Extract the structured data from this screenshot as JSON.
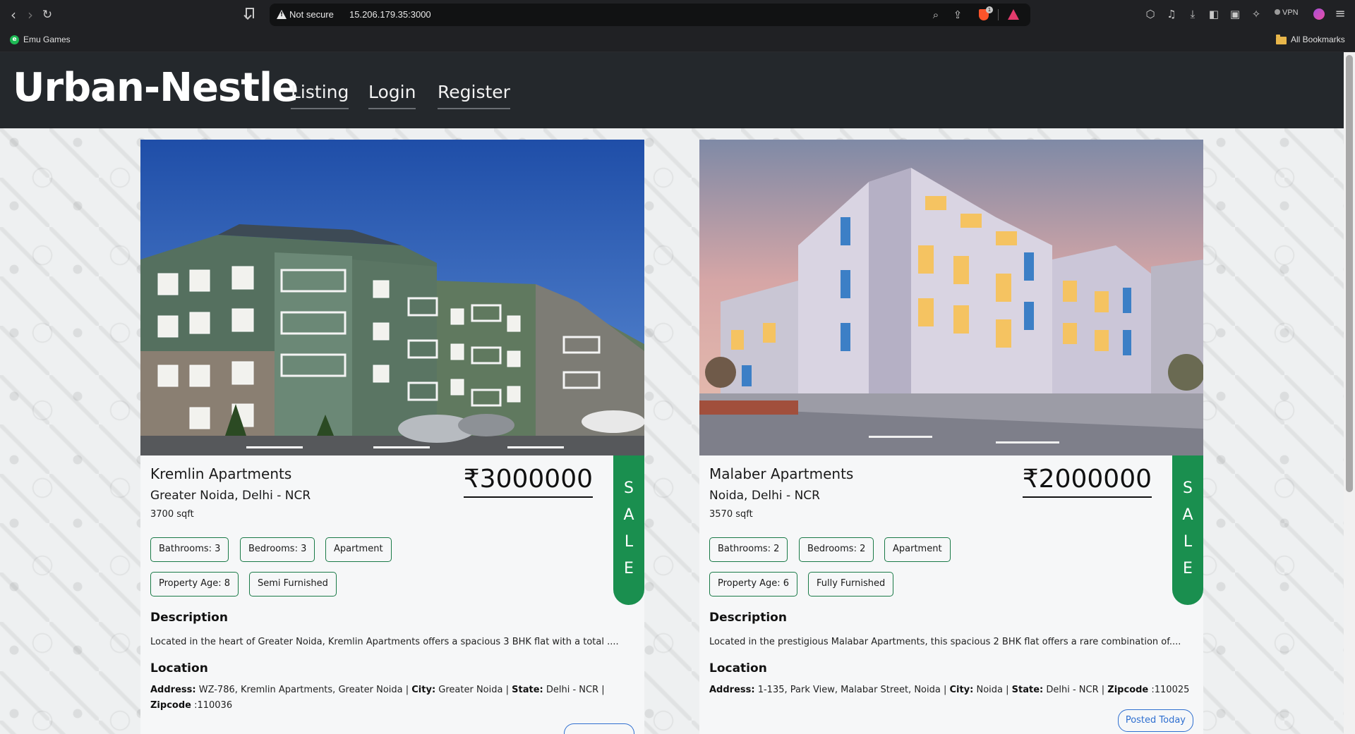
{
  "browser": {
    "security_label": "Not secure",
    "url": "15.206.179.35:3000",
    "shield_count": "1",
    "vpn_label": "VPN",
    "bookmarks": {
      "left_item": "Emu Games",
      "right_item": "All Bookmarks"
    }
  },
  "site": {
    "brand": "Urban-Nestle",
    "nav": [
      "Listing",
      "Login",
      "Register"
    ]
  },
  "listings": [
    {
      "title": "Kremlin Apartments",
      "city": "Greater Noida, Delhi - NCR",
      "area": "3700 sqft",
      "price": "₹3000000",
      "tag_letters": [
        "S",
        "A",
        "L",
        "E"
      ],
      "chips_row1": [
        "Bathrooms: 3",
        "Bedrooms: 3",
        "Apartment"
      ],
      "chips_row2": [
        "Property Age: 8",
        "Semi Furnished"
      ],
      "description_heading": "Description",
      "description": "Located in the heart of Greater Noida, Kremlin Apartments offers a spacious 3 BHK flat with a total ....",
      "location_heading": "Location",
      "address_label": "Address:",
      "address": " WZ-786, Kremlin Apartments, Greater Noida | ",
      "city_label": "City:",
      "city_value": " Greater Noida | ",
      "state_label": "State:",
      "state_value": " Delhi - NCR | ",
      "zip_label": "Zipcode",
      "zip_value": " :110036"
    },
    {
      "title": "Malaber Apartments",
      "city": "Noida, Delhi - NCR",
      "area": "3570 sqft",
      "price": "₹2000000",
      "tag_letters": [
        "S",
        "A",
        "L",
        "E"
      ],
      "chips_row1": [
        "Bathrooms: 2",
        "Bedrooms: 2",
        "Apartment"
      ],
      "chips_row2": [
        "Property Age: 6",
        "Fully Furnished"
      ],
      "description_heading": "Description",
      "description": "Located in the prestigious Malabar Apartments, this spacious 2 BHK flat offers a rare combination of....",
      "location_heading": "Location",
      "address_label": "Address:",
      "address": " 1-135, Park View, Malabar Street, Noida | ",
      "city_label": "City:",
      "city_value": " Noida | ",
      "state_label": "State:",
      "state_value": " Delhi - NCR | ",
      "zip_label": "Zipcode",
      "zip_value": " :110025",
      "posted": "Posted Today"
    }
  ],
  "colors": {
    "header_bg": "#24282c",
    "sale_green": "#1a8f4f",
    "chip_border": "#1a7a47",
    "posted_blue": "#2f6fd0"
  },
  "icons": [
    "back-icon",
    "forward-icon",
    "reload-icon",
    "bookmark-page-icon",
    "warning-icon",
    "zoom-icon",
    "share-icon",
    "brave-shield-icon",
    "rewards-icon",
    "extensions-icon",
    "media-icon",
    "download-icon",
    "sidebar-icon",
    "wallet-icon",
    "leo-icon",
    "menu-icon"
  ]
}
